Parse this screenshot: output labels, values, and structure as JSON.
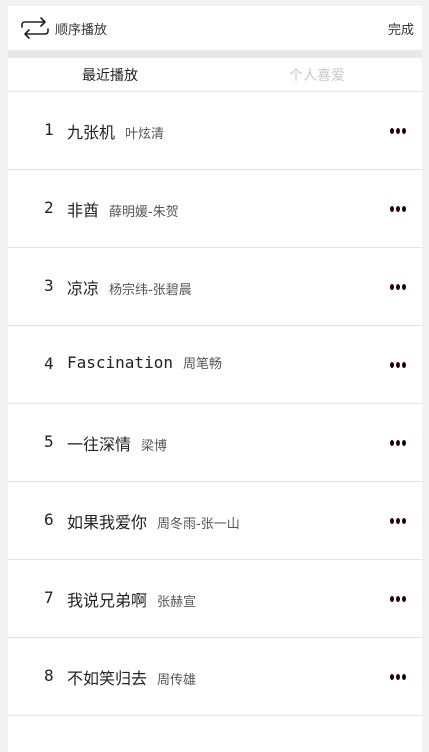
{
  "header": {
    "mode_label": "顺序播放",
    "done_label": "完成"
  },
  "tabs": [
    {
      "label": "最近播放"
    },
    {
      "label": "个人喜爱"
    }
  ],
  "songs": [
    {
      "index": "1",
      "title": "九张机",
      "artist": "叶炫清"
    },
    {
      "index": "2",
      "title": "非酋",
      "artist": "薛明媛-朱贺"
    },
    {
      "index": "3",
      "title": "凉凉",
      "artist": "杨宗纬-张碧晨"
    },
    {
      "index": "4",
      "title": "Fascination",
      "artist": "周笔畅"
    },
    {
      "index": "5",
      "title": "一往深情",
      "artist": "梁博"
    },
    {
      "index": "6",
      "title": "如果我爱你",
      "artist": "周冬雨-张一山"
    },
    {
      "index": "7",
      "title": "我说兄弟啊",
      "artist": "张赫宣"
    },
    {
      "index": "8",
      "title": "不如笑归去",
      "artist": "周传雄"
    }
  ],
  "icons": {
    "mode": "repeat-icon",
    "more": "more-options-icon"
  },
  "colors": {
    "text": "#222222",
    "inactive_tab": "#c8c8c8",
    "dots": "#2a0000",
    "separator": "#e8e8e8"
  }
}
